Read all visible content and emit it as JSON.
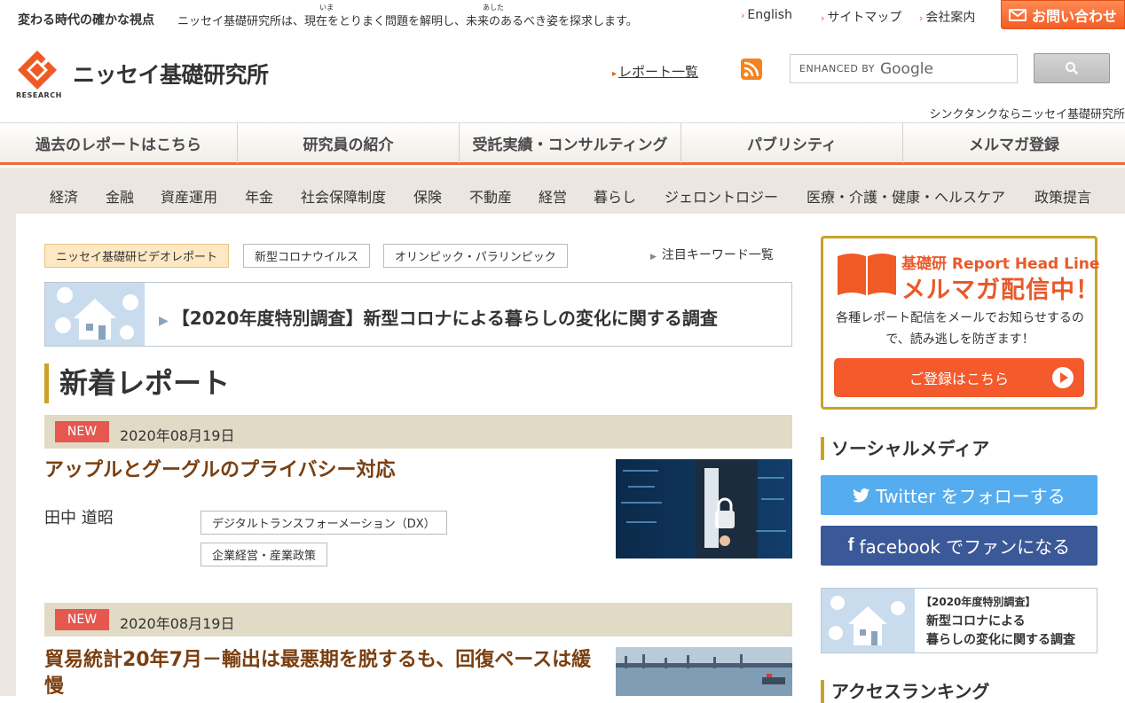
{
  "top": {
    "tagline": "変わる時代の確かな視点",
    "description": "ニッセイ基礎研究所は、現在をとりまく問題を解明し、未来のあるべき姿を探求します。",
    "ruby_ima": "いま",
    "ruby_ashita": "あした",
    "links": {
      "english": "English",
      "sitemap": "サイトマップ",
      "company": "会社案内"
    },
    "contact": "お問い合わせ"
  },
  "header": {
    "logo_text": "ニッセイ基礎研究所",
    "logo_sub": "RESEARCH",
    "report_list": "レポート一覧",
    "search_enhanced": "ENHANCED BY",
    "search_google": "Google",
    "think_tank": "シンクタンクならニッセイ基礎研究所"
  },
  "main_nav": [
    "過去のレポートはこちら",
    "研究員の紹介",
    "受託実績・コンサルティング",
    "パブリシティ",
    "メルマガ登録"
  ],
  "categories": [
    "経済",
    "金融",
    "資産運用",
    "年金",
    "社会保障制度",
    "保険",
    "不動産",
    "経営",
    "暮らし",
    "ジェロントロジー",
    "医療・介護・健康・ヘルスケア",
    "政策提言"
  ],
  "tags": {
    "video": "ニッセイ基礎研ビデオレポート",
    "corona": "新型コロナウイルス",
    "olympic": "オリンピック・パラリンピック",
    "keyword_list": "注目キーワード一覧"
  },
  "banner": {
    "text": "【2020年度特別調査】新型コロナによる暮らしの変化に関する調査"
  },
  "new_reports": {
    "heading": "新着レポート",
    "items": [
      {
        "badge": "NEW",
        "date": "2020年08月19日",
        "title": "アップルとグーグルのプライバシー対応",
        "author": "田中 道昭",
        "tags": [
          "デジタルトランスフォーメーション（DX）",
          "企業経営・産業政策"
        ]
      },
      {
        "badge": "NEW",
        "date": "2020年08月19日",
        "title": "貿易統計20年7月－輸出は最悪期を脱するも、回復ペースは緩慢"
      }
    ]
  },
  "sidebar": {
    "mail": {
      "title1": "基礎研 Report Head Line",
      "title2": "メルマガ配信中！",
      "desc": "各種レポート配信をメールでお知らせするので、読み逃しを防ぎます！",
      "button": "ご登録はこちら"
    },
    "social_heading": "ソーシャルメディア",
    "twitter": "Twitter をフォローする",
    "facebook": "facebook でファンになる",
    "banner": {
      "line1": "【2020年度特別調査】",
      "line2": "新型コロナによる",
      "line3": "暮らしの変化に関する調査"
    },
    "ranking_heading": "アクセスランキング"
  },
  "colors": {
    "accent": "#ef6a3a",
    "gold": "#c9a227",
    "title_brown": "#7a3f10",
    "new_red": "#e5574f",
    "twitter": "#55acee",
    "facebook": "#3b5998"
  }
}
